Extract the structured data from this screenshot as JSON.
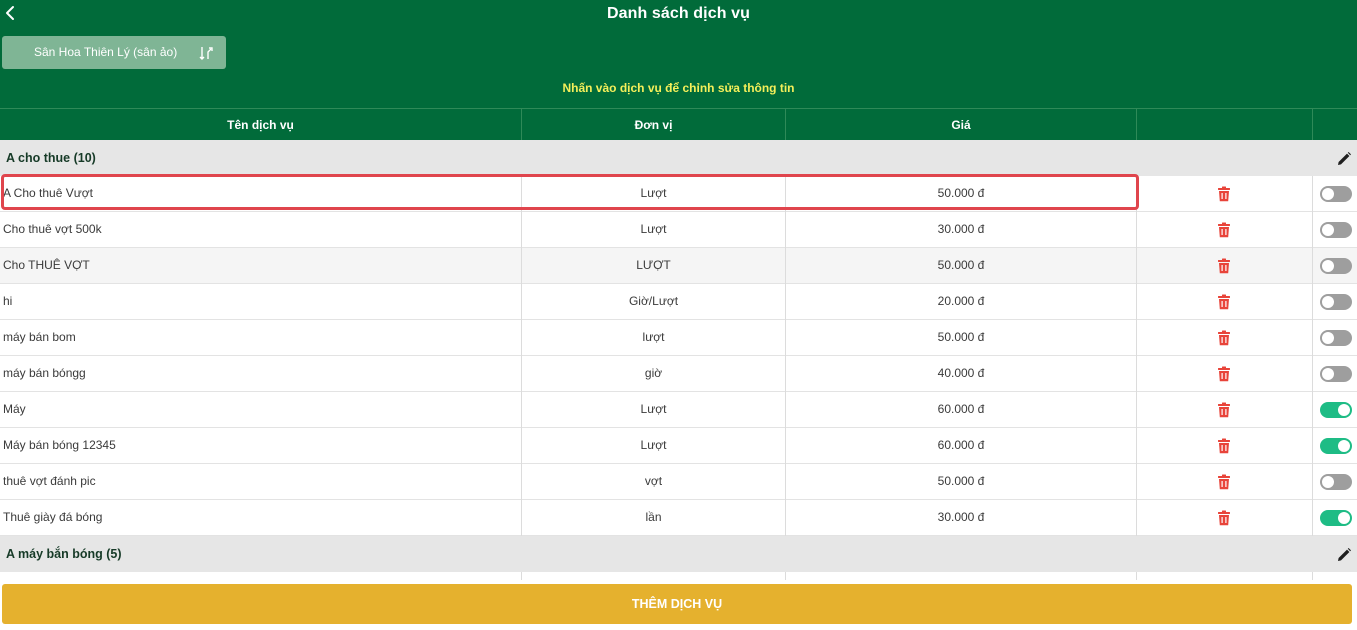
{
  "header": {
    "title": "Danh sách dịch vụ",
    "back_icon": "chevron-left-icon",
    "venue_label": "Sân Hoa Thiên Lý (sân ảo)",
    "venue_icon": "switch-icon",
    "hint": "Nhấn vào dịch vụ để chỉnh sửa thông tin"
  },
  "columns": {
    "name": "Tên dịch vụ",
    "unit": "Đơn vị",
    "price": "Giá",
    "actions": "",
    "status": ""
  },
  "groups": [
    {
      "title": "A cho thue (10)",
      "items": [
        {
          "name": "A Cho thuê Vượt",
          "unit": "Lượt",
          "price": "50.000 đ",
          "active": false
        },
        {
          "name": "Cho thuê vợt 500k",
          "unit": "Lượt",
          "price": "30.000 đ",
          "active": false
        },
        {
          "name": "Cho THUÊ VỢT",
          "unit": "LƯỢT",
          "price": "50.000 đ",
          "active": false
        },
        {
          "name": "hi",
          "unit": "Giờ/Lượt",
          "price": "20.000 đ",
          "active": false
        },
        {
          "name": "máy bán bom",
          "unit": "lượt",
          "price": "50.000 đ",
          "active": false
        },
        {
          "name": "máy bán bóngg",
          "unit": "giờ",
          "price": "40.000 đ",
          "active": false
        },
        {
          "name": "Máy",
          "unit": "Lượt",
          "price": "60.000 đ",
          "active": true
        },
        {
          "name": "Máy bán bóng 12345",
          "unit": "Lượt",
          "price": "60.000 đ",
          "active": true
        },
        {
          "name": "thuê vợt đánh pic",
          "unit": "vợt",
          "price": "50.000 đ",
          "active": false
        },
        {
          "name": "Thuê giày đá bóng",
          "unit": "lần",
          "price": "30.000 đ",
          "active": true
        }
      ]
    },
    {
      "title": "A máy bắn bóng (5)",
      "items": []
    }
  ],
  "add_button": "THÊM DỊCH VỤ",
  "colors": {
    "header_bg": "#016b3a",
    "hint_text": "#f4ef5a",
    "toggle_on": "#1ebc85",
    "delete": "#e8443a",
    "add_button": "#e5b12e"
  }
}
